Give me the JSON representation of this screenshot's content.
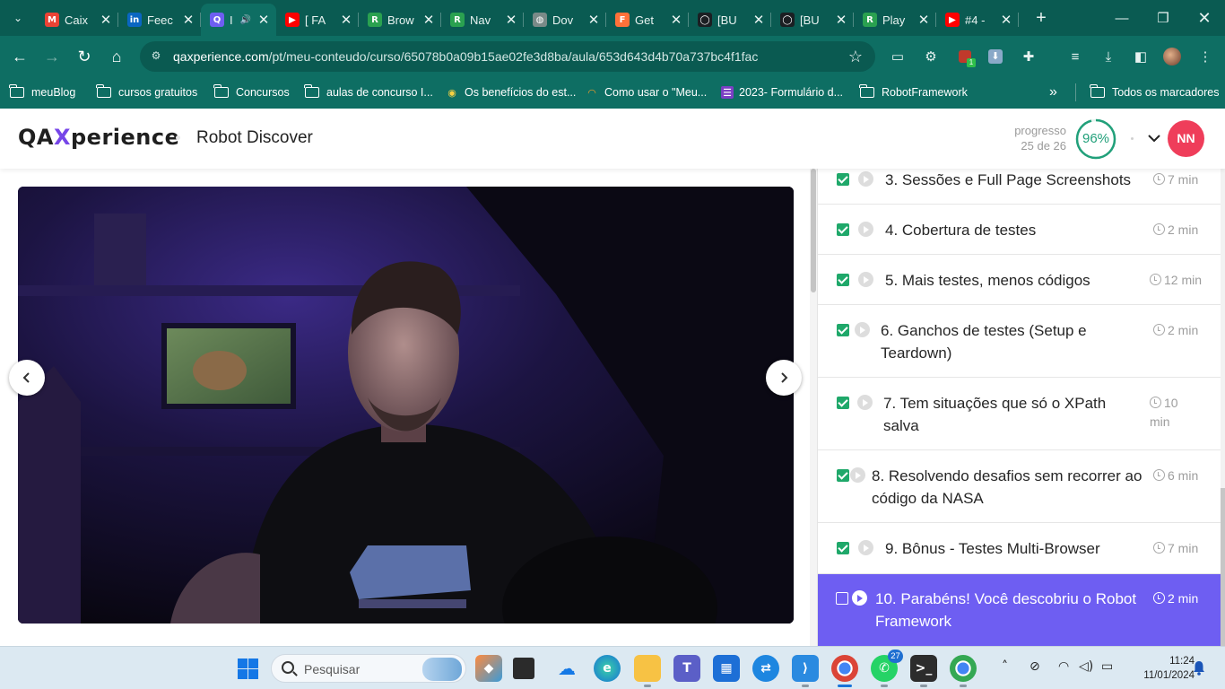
{
  "colors": {
    "browser_frame": "#0a5b52",
    "browser_toolbar": "#0e6e63",
    "accent_purple": "#6e5ef2",
    "check_green": "#1fa86a",
    "progress_green": "#21a07a",
    "avatar_red": "#ef3d5a"
  },
  "browser": {
    "tabs": [
      {
        "title": "Caix",
        "icon": "gmail-icon",
        "color": "#ea4335",
        "glyph": "M"
      },
      {
        "title": "Feec",
        "icon": "linkedin-icon",
        "color": "#0a66c2",
        "glyph": "in"
      },
      {
        "title": "I",
        "icon": "qaxperience-icon",
        "color": "#6e5ef2",
        "glyph": "Q",
        "active": true
      },
      {
        "title": "[ FA",
        "icon": "youtube-icon",
        "color": "#ff0000",
        "glyph": "▶"
      },
      {
        "title": "Brow",
        "icon": "robot-icon",
        "color": "#2aa150",
        "glyph": "R"
      },
      {
        "title": "Nav",
        "icon": "robot-icon",
        "color": "#2aa150",
        "glyph": "R"
      },
      {
        "title": "Dov",
        "icon": "globe-icon",
        "color": "#7a8a88",
        "glyph": "◍"
      },
      {
        "title": "Get",
        "icon": "firefox-icon",
        "color": "#ff7139",
        "glyph": "F"
      },
      {
        "title": "[BU",
        "icon": "github-icon",
        "color": "#1b1f23",
        "glyph": "◯"
      },
      {
        "title": "[BU",
        "icon": "github-icon",
        "color": "#1b1f23",
        "glyph": "◯"
      },
      {
        "title": "Play",
        "icon": "robot-icon",
        "color": "#2aa150",
        "glyph": "R"
      },
      {
        "title": "#4 -",
        "icon": "youtube-icon",
        "color": "#ff0000",
        "glyph": "▶"
      }
    ],
    "url_host": "qaxperience.com",
    "url_path": "/pt/meu-conteudo/curso/65078b0a09b15ae02fe3d8ba/aula/653d643d4b70a737bc4f1fac",
    "bookmarks": [
      {
        "label": "meuBlog",
        "icon": "folder-icon"
      },
      {
        "label": "cursos gratuitos",
        "icon": "folder-icon"
      },
      {
        "label": "Concursos",
        "icon": "folder-icon"
      },
      {
        "label": "aulas de concurso I...",
        "icon": "folder-icon"
      },
      {
        "label": "Os benefícios do est...",
        "icon": "leaf-icon"
      },
      {
        "label": "Como usar o \"Meu...",
        "icon": "spinner-icon"
      },
      {
        "label": "2023- Formulário d...",
        "icon": "forms-icon"
      },
      {
        "label": "RobotFramework",
        "icon": "folder-icon"
      }
    ],
    "bookmarks_overflow": "»",
    "all_bookmarks": "Todos os marcadores"
  },
  "site": {
    "logo_pre": "QA",
    "logo_x": "X",
    "logo_post": "perience",
    "course_title": "Robot Discover",
    "progress_label": "progresso",
    "progress_count": "25 de 26",
    "progress_percent_text": "96%",
    "progress_value": 0.96,
    "avatar_initials": "NN"
  },
  "lessons": [
    {
      "title": "3. Sessões e Full Page Screenshots",
      "duration": "7 min",
      "done": true
    },
    {
      "title": "4. Cobertura de testes",
      "duration": "2 min",
      "done": true
    },
    {
      "title": "5. Mais testes, menos códigos",
      "duration": "12 min",
      "done": true
    },
    {
      "title": "6. Ganchos de testes (Setup e Teardown)",
      "duration": "2 min",
      "done": true
    },
    {
      "title": "7. Tem situações que só o XPath salva",
      "duration": "10 min",
      "done": true
    },
    {
      "title": "8. Resolvendo desafios sem recorrer ao código da NASA",
      "duration": "6 min",
      "done": true
    },
    {
      "title": "9. Bônus - Testes Multi-Browser",
      "duration": "7 min",
      "done": true
    },
    {
      "title": "10. Parabéns! Você descobriu o Robot Framework",
      "duration": "2 min",
      "done": false,
      "current": true
    }
  ],
  "taskbar": {
    "search_placeholder": "Pesquisar",
    "whatsapp_badge": "27",
    "time": "11:24",
    "date": "11/01/2024"
  }
}
